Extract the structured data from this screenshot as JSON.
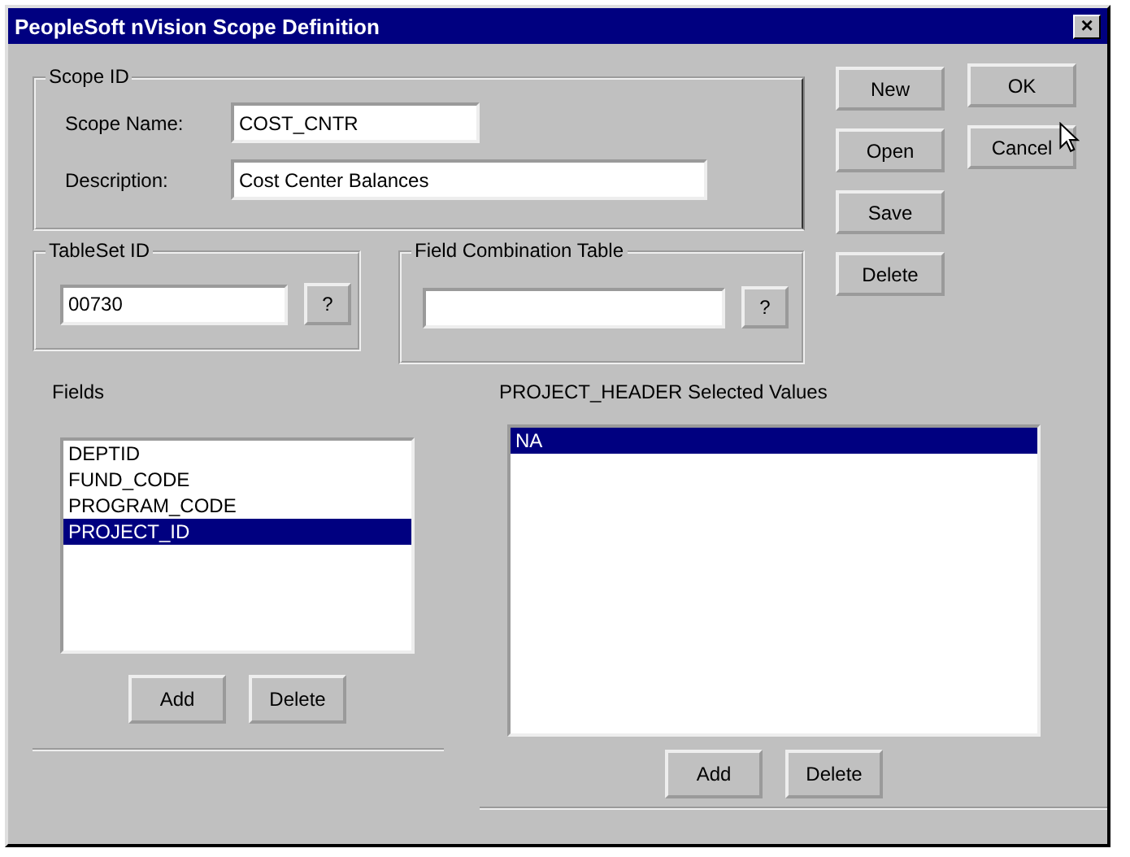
{
  "window": {
    "title": "PeopleSoft nVision Scope Definition",
    "close": "×"
  },
  "scope_id": {
    "title": "Scope ID",
    "fields": [
      {
        "label": "Scope Name:",
        "value": "COST_CNTR",
        "kind": "short"
      },
      {
        "label": "Description:",
        "value": "Cost Center Balances",
        "kind": "long"
      }
    ]
  },
  "tableset_id": {
    "title": "TableSet ID",
    "value": "00730",
    "lookup": "?"
  },
  "field_combination_table": {
    "title": "Field Combination Table",
    "lookup": "?"
  },
  "side_buttons": [
    [
      "New",
      "Open",
      "Save",
      "Delete"
    ],
    [
      "OK",
      "Cancel"
    ]
  ],
  "fields": {
    "title": "Fields",
    "items": [
      {
        "label": "DEPTID",
        "selected": false
      },
      {
        "label": "FUND_CODE",
        "selected": false
      },
      {
        "label": "PROGRAM_CODE",
        "selected": false
      },
      {
        "label": "PROJECT_ID",
        "selected": true
      }
    ],
    "buttons": [
      "Add",
      "Delete"
    ]
  },
  "selected_values": {
    "title": "PROJECT_HEADER Selected Values",
    "items": [
      {
        "label": "NA",
        "selected": true
      }
    ],
    "buttons": [
      "Add",
      "Delete"
    ]
  }
}
